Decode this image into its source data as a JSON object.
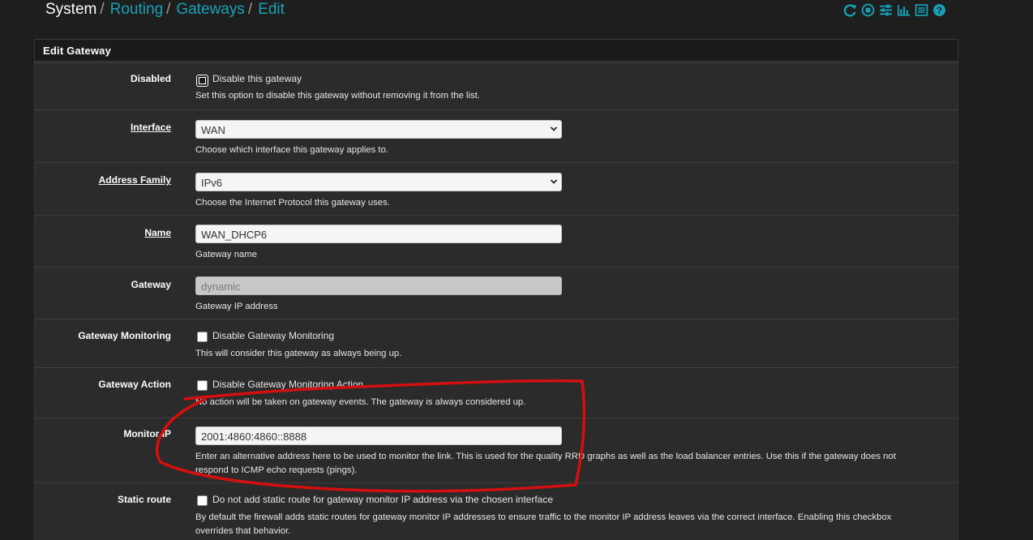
{
  "breadcrumb": {
    "items": [
      "System",
      "Routing",
      "Gateways",
      "Edit"
    ],
    "separator": "/"
  },
  "header_icons": [
    "reload-icon",
    "stop-icon",
    "sliders-icon",
    "bar-chart-icon",
    "list-icon",
    "help-icon"
  ],
  "panel": {
    "title": "Edit Gateway"
  },
  "form": {
    "disabled": {
      "label": "Disabled",
      "checkbox_label": "Disable this gateway",
      "checked": true,
      "help": "Set this option to disable this gateway without removing it from the list."
    },
    "interface": {
      "label": "Interface",
      "value": "WAN",
      "help": "Choose which interface this gateway applies to."
    },
    "address_family": {
      "label": "Address Family",
      "value": "IPv6",
      "help": "Choose the Internet Protocol this gateway uses."
    },
    "name": {
      "label": "Name",
      "value": "WAN_DHCP6",
      "help": "Gateway name"
    },
    "gateway": {
      "label": "Gateway",
      "value": "dynamic",
      "help": "Gateway IP address"
    },
    "gateway_monitoring": {
      "label": "Gateway Monitoring",
      "checkbox_label": "Disable Gateway Monitoring",
      "checked": false,
      "help": "This will consider this gateway as always being up."
    },
    "gateway_action": {
      "label": "Gateway Action",
      "checkbox_label": "Disable Gateway Monitoring Action",
      "checked": false,
      "help": "No action will be taken on gateway events. The gateway is always considered up."
    },
    "monitor_ip": {
      "label": "Monitor IP",
      "value": "2001:4860:4860::8888",
      "help_line1": "Enter an alternative address here to be used to monitor the link. This is used for the quality RRD graphs as well as the load balancer entries. Use this if the gateway does not",
      "help_line2": "respond to ICMP echo requests (pings)."
    },
    "static_route": {
      "label": "Static route",
      "checkbox_label": "Do not add static route for gateway monitor IP address via the chosen interface",
      "checked": false,
      "help_line1": "By default the firewall adds static routes for gateway monitor IP addresses to ensure traffic to the monitor IP address leaves via the correct interface. Enabling this checkbox",
      "help_line2": "overrides that behavior."
    }
  },
  "colors": {
    "link": "#17a2b8",
    "annotation": "#d40f0f",
    "panel_bg": "#2b2b2b",
    "page_bg": "#1e1e1e"
  }
}
